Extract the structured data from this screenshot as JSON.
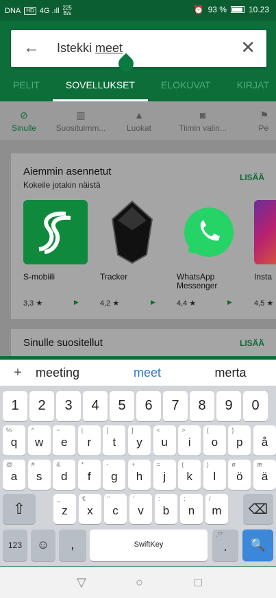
{
  "status": {
    "carrier": "DNA",
    "badge": "HD",
    "signal": "4G .ıll",
    "speed": "225",
    "speed_unit": "B/s",
    "alarm": "⏰",
    "battery": "93 %",
    "time": "10.23"
  },
  "search": {
    "prefix": "Istekki ",
    "typed": "meet"
  },
  "tabs": [
    "PELIT",
    "SOVELLUKSET",
    "ELOKUVAT",
    "KIRJAT"
  ],
  "categories": [
    {
      "icon": "compass-icon",
      "glyph": "⊘",
      "label": "Sinulle"
    },
    {
      "icon": "chart-icon",
      "glyph": "▥",
      "label": "Suosituimm..."
    },
    {
      "icon": "shapes-icon",
      "glyph": "▲",
      "label": "Luokat"
    },
    {
      "icon": "badge-icon",
      "glyph": "◙",
      "label": "Tiimin valin..."
    },
    {
      "icon": "family-icon",
      "glyph": "⚑",
      "label": "Pe"
    }
  ],
  "section1": {
    "title": "Aiemmin asennetut",
    "subtitle": "Kokeile jotakin näistä",
    "more": "LISÄÄ",
    "apps": [
      {
        "name": "S-mobiili",
        "rating": "3,3 ★",
        "color": "#0f8a3c"
      },
      {
        "name": "Tracker",
        "rating": "4,2 ★",
        "color": "#111111"
      },
      {
        "name": "WhatsApp Messenger",
        "rating": "4,4 ★",
        "color": "#25d366"
      },
      {
        "name": "Insta",
        "rating": "4,5 ★",
        "color": "#c13584"
      }
    ]
  },
  "section2": {
    "title": "Sinulle suositellut",
    "more": "LISÄÄ"
  },
  "suggestions": {
    "plus": "+",
    "left": "meeting",
    "center": "meet",
    "right": "merta"
  },
  "keyboard": {
    "numbers": [
      "1",
      "2",
      "3",
      "4",
      "5",
      "6",
      "7",
      "8",
      "9",
      "0"
    ],
    "row1": [
      {
        "m": "q",
        "s": "%"
      },
      {
        "m": "w",
        "s": "^"
      },
      {
        "m": "e",
        "s": "~"
      },
      {
        "m": "r",
        "s": "|"
      },
      {
        "m": "t",
        "s": "["
      },
      {
        "m": "y",
        "s": "]"
      },
      {
        "m": "u",
        "s": "<"
      },
      {
        "m": "i",
        "s": ">"
      },
      {
        "m": "o",
        "s": "{"
      },
      {
        "m": "p",
        "s": "}"
      },
      {
        "m": "å",
        "s": ""
      }
    ],
    "row2": [
      {
        "m": "a",
        "s": "@"
      },
      {
        "m": "s",
        "s": "#"
      },
      {
        "m": "d",
        "s": "&"
      },
      {
        "m": "f",
        "s": "*"
      },
      {
        "m": "g",
        "s": "-"
      },
      {
        "m": "h",
        "s": "+"
      },
      {
        "m": "j",
        "s": "="
      },
      {
        "m": "k",
        "s": "("
      },
      {
        "m": "l",
        "s": ")"
      },
      {
        "m": "ö",
        "s": "ø"
      },
      {
        "m": "ä",
        "s": "æ"
      }
    ],
    "row3": [
      {
        "m": "z",
        "s": "_"
      },
      {
        "m": "x",
        "s": "€"
      },
      {
        "m": "c",
        "s": "\""
      },
      {
        "m": "v",
        "s": "'"
      },
      {
        "m": "b",
        "s": ":"
      },
      {
        "m": "n",
        "s": ";"
      },
      {
        "m": "m",
        "s": "/"
      }
    ],
    "shift": "⇧",
    "backspace": "⌫",
    "sym": "123",
    "emoji": "☺",
    "comma": ",",
    "space": "SwiftKey",
    "period": ".",
    "period_alt": ",!?",
    "enter": "🔍"
  },
  "nav": {
    "back": "▽",
    "home": "○",
    "recents": "□"
  }
}
